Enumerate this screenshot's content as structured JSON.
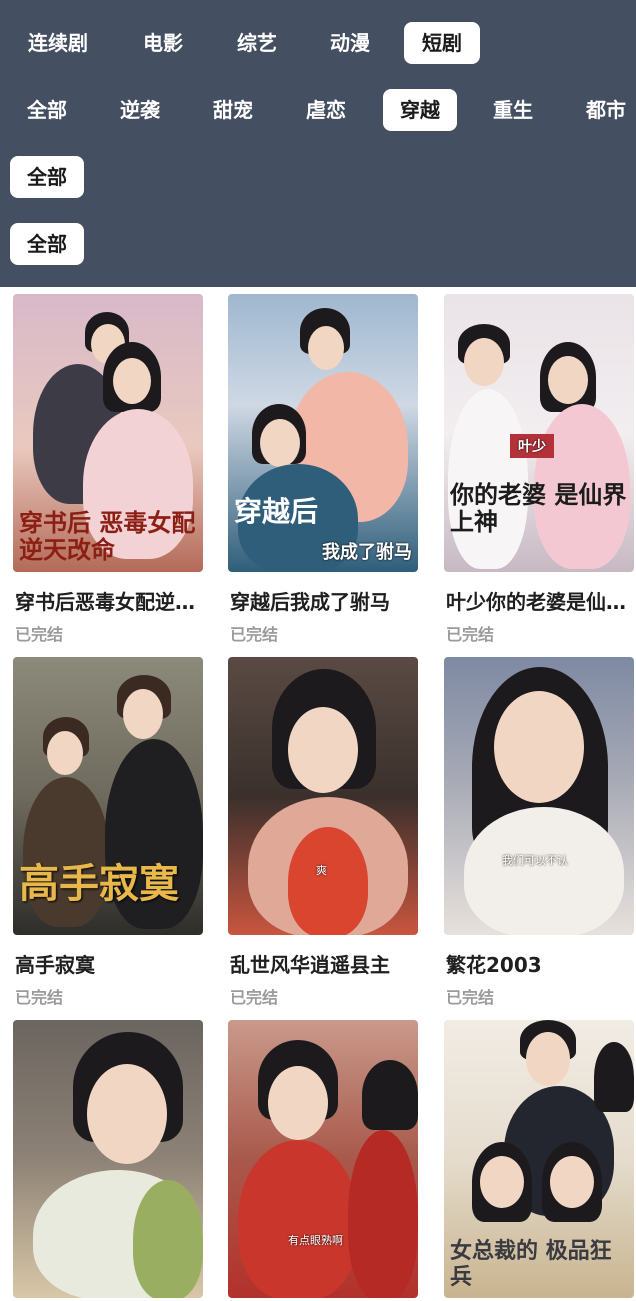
{
  "category_tabs": [
    "连续剧",
    "电影",
    "综艺",
    "动漫",
    "短剧"
  ],
  "category_active": "短剧",
  "genre_tabs": [
    "全部",
    "逆袭",
    "甜宠",
    "虐恋",
    "穿越",
    "重生",
    "都市"
  ],
  "genre_active": "穿越",
  "filter_row_3": "全部",
  "filter_row_4": "全部",
  "shows": [
    {
      "title": "穿书后恶毒女配逆天改命",
      "status": "已完结",
      "poster_text": "穿书后 恶毒女配逆天改命",
      "colors": [
        "#d9b9c9",
        "#b46a58"
      ]
    },
    {
      "title": "穿越后我成了驸马",
      "status": "已完结",
      "poster_text": "穿越后",
      "poster_sub": "我成了驸马",
      "colors": [
        "#9fb7cf",
        "#2f5e7a"
      ]
    },
    {
      "title": "叶少你的老婆是仙界上神",
      "status": "已完结",
      "poster_text": "你的老婆 是仙界上神",
      "poster_tag": "叶少",
      "colors": [
        "#eae3e7",
        "#c7b9c3"
      ]
    },
    {
      "title": "高手寂寞",
      "status": "已完结",
      "poster_text": "高手寂寞",
      "colors": [
        "#8c8a7b",
        "#2e2d2a"
      ]
    },
    {
      "title": "乱世风华逍遥县主",
      "status": "已完结",
      "poster_text": "",
      "poster_caption": "爽",
      "colors": [
        "#5a4a43",
        "#c8553f"
      ]
    },
    {
      "title": "繁花2003",
      "status": "已完结",
      "poster_text": "",
      "poster_caption": "我们可以不认",
      "colors": [
        "#7e8aa3",
        "#e7e1dc"
      ]
    },
    {
      "title": "",
      "status": "",
      "poster_text": "",
      "colors": [
        "#6b6560",
        "#d9c7a8"
      ]
    },
    {
      "title": "",
      "status": "",
      "poster_text": "",
      "poster_caption": "有点眼熟啊",
      "colors": [
        "#c99a8b",
        "#b3312b"
      ]
    },
    {
      "title": "",
      "status": "",
      "poster_text": "女总裁的 极品狂兵",
      "colors": [
        "#f1ece4",
        "#c8b48f"
      ]
    }
  ]
}
